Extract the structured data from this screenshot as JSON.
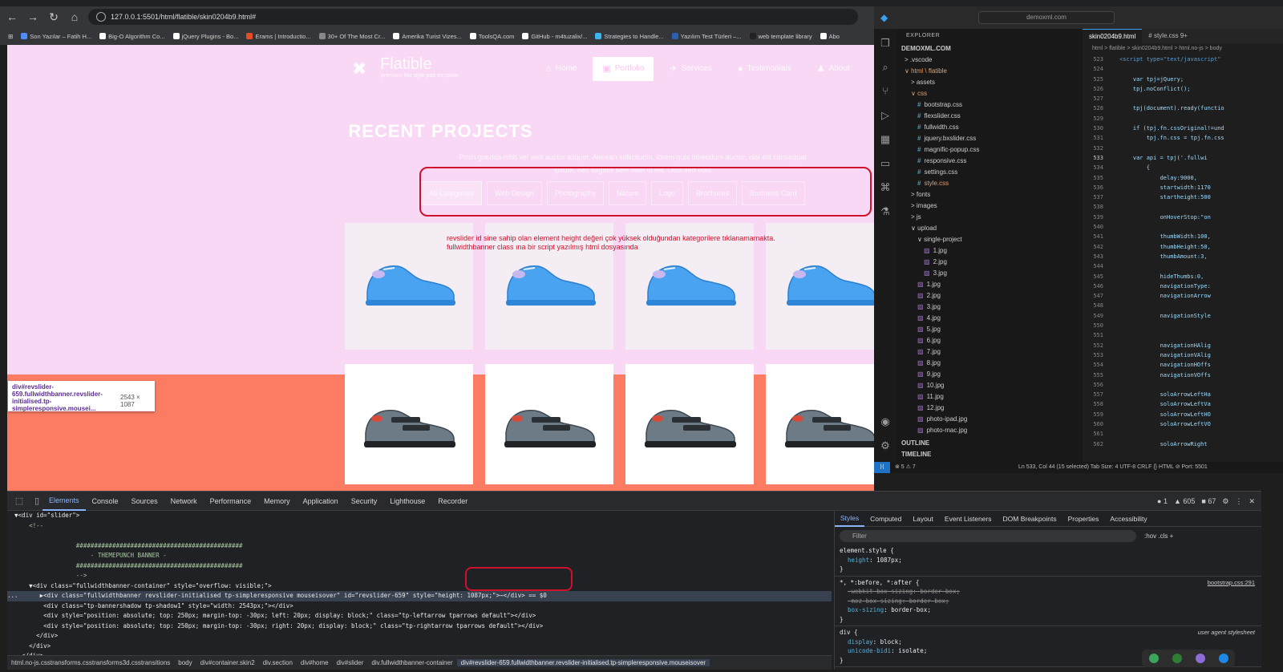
{
  "browser": {
    "url": "127.0.0.1:5501/html/flatible/skin0204b9.html#",
    "bookmarks": [
      {
        "label": "Son Yazılar – Fatih H...",
        "color": "#4f8cff"
      },
      {
        "label": "Big-O Algorithm Co...",
        "color": "#ffffff"
      },
      {
        "label": "jQuery Plugins - Bo...",
        "color": "#ffffff"
      },
      {
        "label": "Erams | Introductio...",
        "color": "#e44d26"
      },
      {
        "label": "30+ Of The Most Cr...",
        "color": "#888888"
      },
      {
        "label": "Amerika Turist Vizes...",
        "color": "#ffffff"
      },
      {
        "label": "ToolsQA.com",
        "color": "#ffffff"
      },
      {
        "label": "GitHub - m4tuzalix/...",
        "color": "#ffffff"
      },
      {
        "label": "Strategies to Handle...",
        "color": "#3bb4f2"
      },
      {
        "label": "Yazılım Test Türleri –...",
        "color": "#2b5fb4"
      },
      {
        "label": "web template library",
        "color": "#222222"
      },
      {
        "label": "Abo",
        "color": "#ffffff"
      }
    ]
  },
  "site": {
    "logo_title": "Flatible",
    "logo_tagline": "premium flat style psd template",
    "menu": [
      {
        "label": "Home",
        "icon": "home-icon",
        "glyph": "⌂",
        "active": false
      },
      {
        "label": "Portfolio",
        "icon": "briefcase-icon",
        "glyph": "▣",
        "active": true
      },
      {
        "label": "Services",
        "icon": "plane-icon",
        "glyph": "✈",
        "active": false
      },
      {
        "label": "Testimonials",
        "icon": "comment-icon",
        "glyph": "●",
        "active": false
      },
      {
        "label": "About",
        "icon": "user-icon",
        "glyph": "♟",
        "active": false
      }
    ],
    "section_title": "RECENT PROJECTS",
    "section_desc": "Proin gravida nibh vel velit auctor aliquet. Aenean sollicitudin, lorem quis bibendum auctor, nisi elit consequat ipsum, nec sagittis sem nibh id elit. Duis sed odio",
    "filters": [
      "All Categories",
      "Web Design",
      "Photography",
      "Nature",
      "Logo",
      "Brochures",
      "Business Card"
    ],
    "active_filter": 0,
    "annotation": "revslider id sine sahip olan element height değeri çok yüksek olduğundan kategorilere tıklanamamakta. fullwidthbanner class ına bir script yazılmış html dosyasında",
    "products_top": [
      "safety shoe 1",
      "safety shoe 2",
      "safety boot 3",
      "safety shoe 4"
    ],
    "products_bottom": [
      "sandal 1",
      "sandal 2",
      "sandal 3",
      "sandal 4"
    ],
    "inspect_tooltip": {
      "selector": "div#revslider-659.fullwidthbanner.revslider-initialised.tp-simpleresponsive.mousei...",
      "size": "2543 × 1087"
    }
  },
  "vscode": {
    "search": "demoxml.com",
    "explorer_title": "EXPLORER",
    "workspace": "DEMOXML.COM",
    "tree": [
      {
        "label": "> .vscode",
        "type": "folder",
        "indent": 0,
        "orange": false
      },
      {
        "label": "∨ html \\ flatible",
        "type": "folder",
        "indent": 0,
        "orange": true
      },
      {
        "label": "> assets",
        "type": "folder",
        "indent": 1,
        "orange": false
      },
      {
        "label": "∨ css",
        "type": "folder",
        "indent": 1,
        "orange": true
      },
      {
        "label": "bootstrap.css",
        "type": "css",
        "indent": 2,
        "orange": false
      },
      {
        "label": "flexslider.css",
        "type": "css",
        "indent": 2,
        "orange": false
      },
      {
        "label": "fullwidth.css",
        "type": "css",
        "indent": 2,
        "orange": false
      },
      {
        "label": "jquery.bxslider.css",
        "type": "css",
        "indent": 2,
        "orange": false
      },
      {
        "label": "magnific-popup.css",
        "type": "css",
        "indent": 2,
        "orange": false
      },
      {
        "label": "responsive.css",
        "type": "css",
        "indent": 2,
        "orange": false
      },
      {
        "label": "settings.css",
        "type": "css",
        "indent": 2,
        "orange": false
      },
      {
        "label": "style.css",
        "type": "css",
        "indent": 2,
        "orange": true
      },
      {
        "label": "> fonts",
        "type": "folder",
        "indent": 1,
        "orange": false
      },
      {
        "label": "> images",
        "type": "folder",
        "indent": 1,
        "orange": false
      },
      {
        "label": "> js",
        "type": "folder",
        "indent": 1,
        "orange": false
      },
      {
        "label": "∨ upload",
        "type": "folder",
        "indent": 1,
        "orange": false
      },
      {
        "label": "∨ single-project",
        "type": "folder",
        "indent": 2,
        "orange": false
      },
      {
        "label": "1.jpg",
        "type": "img",
        "indent": 3,
        "orange": false
      },
      {
        "label": "2.jpg",
        "type": "img",
        "indent": 3,
        "orange": false
      },
      {
        "label": "3.jpg",
        "type": "img",
        "indent": 3,
        "orange": false
      },
      {
        "label": "1.jpg",
        "type": "img",
        "indent": 2,
        "orange": false
      },
      {
        "label": "2.jpg",
        "type": "img",
        "indent": 2,
        "orange": false
      },
      {
        "label": "3.jpg",
        "type": "img",
        "indent": 2,
        "orange": false
      },
      {
        "label": "4.jpg",
        "type": "img",
        "indent": 2,
        "orange": false
      },
      {
        "label": "5.jpg",
        "type": "img",
        "indent": 2,
        "orange": false
      },
      {
        "label": "6.jpg",
        "type": "img",
        "indent": 2,
        "orange": false
      },
      {
        "label": "7.jpg",
        "type": "img",
        "indent": 2,
        "orange": false
      },
      {
        "label": "8.jpg",
        "type": "img",
        "indent": 2,
        "orange": false
      },
      {
        "label": "9.jpg",
        "type": "img",
        "indent": 2,
        "orange": false
      },
      {
        "label": "10.jpg",
        "type": "img",
        "indent": 2,
        "orange": false
      },
      {
        "label": "11.jpg",
        "type": "img",
        "indent": 2,
        "orange": false
      },
      {
        "label": "12.jpg",
        "type": "img",
        "indent": 2,
        "orange": false
      },
      {
        "label": "photo-ipad.jpg",
        "type": "img",
        "indent": 2,
        "orange": false
      },
      {
        "label": "photo-mac.jpg",
        "type": "img",
        "indent": 2,
        "orange": false
      }
    ],
    "outline": "OUTLINE",
    "timeline": "TIMELINE",
    "tabs": [
      "skin0204b9.html",
      "# style.css 9+"
    ],
    "breadcrumb": "html > flatible > skin0204b9.html > html.no-js > body",
    "code": [
      {
        "n": "523",
        "t": "<script type=\"text/javascript\""
      },
      {
        "n": "524",
        "t": ""
      },
      {
        "n": "525",
        "t": "    var tpj=jQuery;"
      },
      {
        "n": "526",
        "t": "    tpj.noConflict();"
      },
      {
        "n": "527",
        "t": ""
      },
      {
        "n": "528",
        "t": "    tpj(document).ready(functio"
      },
      {
        "n": "529",
        "t": ""
      },
      {
        "n": "530",
        "t": "    if (tpj.fn.cssOriginal!=und"
      },
      {
        "n": "531",
        "t": "        tpj.fn.css = tpj.fn.css"
      },
      {
        "n": "532",
        "t": ""
      },
      {
        "n": "533",
        "t": "    var api = tpj('.fullwi"
      },
      {
        "n": "534",
        "t": "        {"
      },
      {
        "n": "535",
        "t": "            delay:9000,"
      },
      {
        "n": "536",
        "t": "            startwidth:1170"
      },
      {
        "n": "537",
        "t": "            startheight:500"
      },
      {
        "n": "538",
        "t": ""
      },
      {
        "n": "539",
        "t": "            onHoverStop:\"on"
      },
      {
        "n": "540",
        "t": ""
      },
      {
        "n": "541",
        "t": "            thumbWidth:100,"
      },
      {
        "n": "542",
        "t": "            thumbHeight:50,"
      },
      {
        "n": "543",
        "t": "            thumbAmount:3,"
      },
      {
        "n": "544",
        "t": ""
      },
      {
        "n": "545",
        "t": "            hideThumbs:0,"
      },
      {
        "n": "546",
        "t": "            navigationType:"
      },
      {
        "n": "547",
        "t": "            navigationArrow"
      },
      {
        "n": "548",
        "t": ""
      },
      {
        "n": "549",
        "t": "            navigationStyle"
      },
      {
        "n": "550",
        "t": ""
      },
      {
        "n": "551",
        "t": ""
      },
      {
        "n": "552",
        "t": "            navigationHAlig"
      },
      {
        "n": "553",
        "t": "            navigationVAlig"
      },
      {
        "n": "554",
        "t": "            navigationHOffs"
      },
      {
        "n": "555",
        "t": "            navigationVOffs"
      },
      {
        "n": "556",
        "t": ""
      },
      {
        "n": "557",
        "t": "            soloArrowLeftHa"
      },
      {
        "n": "558",
        "t": "            soloArrowLeftVa"
      },
      {
        "n": "559",
        "t": "            soloArrowLeftHO"
      },
      {
        "n": "560",
        "t": "            soloArrowLeftVO"
      },
      {
        "n": "561",
        "t": ""
      },
      {
        "n": "562",
        "t": "            soloArrowRight"
      }
    ],
    "status": "Ln 533, Col 44 (15 selected)   Tab Size: 4   UTF-8   CRLF   {} HTML   ⊘ Port: 5501",
    "status_left": "⊗ 5 ⚠ 7"
  },
  "devtools": {
    "tabs": [
      "Elements",
      "Console",
      "Sources",
      "Network",
      "Performance",
      "Memory",
      "Application",
      "Security",
      "Lighthouse",
      "Recorder"
    ],
    "active_tab": 0,
    "badges": [
      "● 1",
      "▲ 605",
      "■ 67"
    ],
    "dom_lines": [
      {
        "t": "  ▼<div id=\"slider\">",
        "cls": ""
      },
      {
        "t": "      <!--",
        "cls": "comment"
      },
      {
        "t": "",
        "cls": "comment"
      },
      {
        "t": "                   ##############################################",
        "cls": "comment"
      },
      {
        "t": "                       - THEMEPUNCH BANNER -",
        "cls": "comment"
      },
      {
        "t": "                   ##############################################",
        "cls": "comment"
      },
      {
        "t": "                   -->",
        "cls": "comment"
      },
      {
        "t": "      ▼<div class=\"fullwidthbanner-container\" style=\"overflow: visible;\">",
        "cls": ""
      },
      {
        "t": "...      ▶<div class=\"fullwidthbanner revslider-initialised tp-simpleresponsive mouseisover\" id=\"revslider-659\" style=\"height: 1087px;\">⋯</div> == $0",
        "cls": "sel"
      },
      {
        "t": "          <div class=\"tp-bannershadow tp-shadow1\" style=\"width: 2543px;\"></div>",
        "cls": ""
      },
      {
        "t": "          <div style=\"position: absolute; top: 250px; margin-top: -30px; left: 20px; display: block;\" class=\"tp-leftarrow tparrows default\"></div>",
        "cls": ""
      },
      {
        "t": "          <div style=\"position: absolute; top: 250px; margin-top: -30px; right: 20px; display: block;\" class=\"tp-rightarrow tparrows default\"></div>",
        "cls": ""
      },
      {
        "t": "        </div>",
        "cls": ""
      },
      {
        "t": "      </div>",
        "cls": ""
      },
      {
        "t": "    </div>",
        "cls": ""
      }
    ],
    "crumbs": [
      "html.no-js.csstransforms.csstransforms3d.csstransitions",
      "body",
      "div#container.skin2",
      "div.section",
      "div#home",
      "div#slider",
      "div.fullwidthbanner-container",
      "div#revslider-659.fullwidthbanner.revslider-initialised.tp-simpleresponsive.mouseisover"
    ],
    "styles_tabs": [
      "Styles",
      "Computed",
      "Layout",
      "Event Listeners",
      "DOM Breakpoints",
      "Properties",
      "Accessibility"
    ],
    "filter_placeholder": "Filter",
    "hov_cls": ":hov  .cls  +",
    "rules": [
      {
        "sel": "element.style {",
        "src": "",
        "props": [
          {
            "p": "height",
            "v": "1087px;",
            "strike": false
          }
        ]
      },
      {
        "sel": "*, *:before, *:after {",
        "src": "bootstrap.css:291",
        "props": [
          {
            "p": "-webkit-box-sizing",
            "v": "border-box;",
            "strike": true
          },
          {
            "p": "-moz-box-sizing",
            "v": "border-box;",
            "strike": true
          },
          {
            "p": "box-sizing",
            "v": "border-box;",
            "strike": false
          }
        ]
      },
      {
        "sel": "div {",
        "src": "user agent stylesheet",
        "props": [
          {
            "p": "display",
            "v": "block;",
            "strike": false
          },
          {
            "p": "unicode-bidi",
            "v": "isolate;",
            "strike": false
          }
        ]
      }
    ]
  },
  "colors": {
    "page_bg": "#f8d8f4",
    "coral": "#fb7c62",
    "annotation_red": "#d0112b",
    "devtools_accent": "#8ab4f8"
  }
}
